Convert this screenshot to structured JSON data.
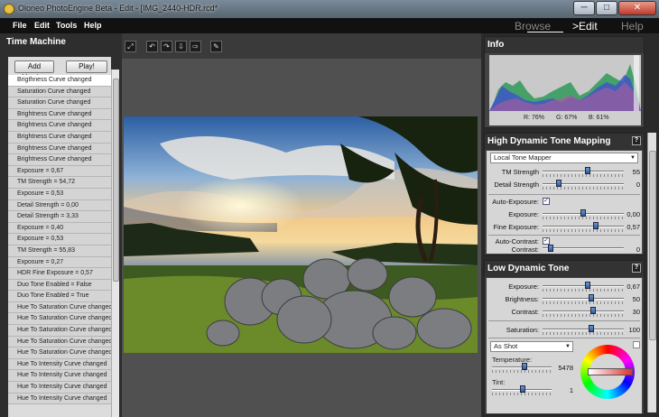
{
  "window": {
    "title": "Oloneo PhotoEngine Beta - Edit - [IMG_2440-HDR.rcd*",
    "minimize": "─",
    "maximize": "□",
    "close": "✕"
  },
  "menu": {
    "file": "File",
    "edit": "Edit",
    "tools": "Tools",
    "help": "Help"
  },
  "modes": {
    "browse": "Browse",
    "edit": ">Edit",
    "help": "Help"
  },
  "time_machine": {
    "title": "Time Machine",
    "add_version": "Add Version",
    "play": "Play!",
    "items": [
      "Brigthness Curve changed",
      "Saturation Curve changed",
      "Saturation Curve changed",
      "Brightness Curve changed",
      "Brightness Curve changed",
      "Brightness Curve changed",
      "Brightness Curve changed",
      "Brightness Curve changed",
      "Exposure = 0,67",
      "TM Strength = 54,72",
      "Exposure = 0,53",
      "Detail Strength = 0,00",
      "Detail Strength = 3,33",
      "Exposure = 0,40",
      "Exposure = 0,53",
      "TM Strength = 55,83",
      "Exposure = 0,27",
      "HDR Fine Exposure = 0,57",
      "Duo Tone Enabled = False",
      "Duo Tone Enabled = True",
      "Hue To Saturation Curve changed",
      "Hue To Saturation Curve changed",
      "Hue To Saturation Curve changed",
      "Hue To Saturation Curve changed",
      "Hue To Saturation Curve changed",
      "Hue To Intensity Curve changed",
      "Hue To Intensity Curve changed",
      "Hue To Intensity Curve changed",
      "Hue To Intensity Curve changed"
    ]
  },
  "toolbar_icons": [
    "fit-icon",
    "rotate-left-icon",
    "rotate-right-icon",
    "flip-vertical-icon",
    "flip-horizontal-icon",
    "crop-icon"
  ],
  "info": {
    "title": "Info",
    "r": "R: 76%",
    "g": "G: 67%",
    "b": "B: 61%"
  },
  "hdr": {
    "title": "High Dynamic Tone Mapping",
    "help": "?",
    "mapper": "Local Tone Mapper",
    "tm_strength": {
      "label": "TM Strength",
      "value": "55",
      "level": 0.55
    },
    "detail_strength": {
      "label": "Detail Strength",
      "value": "0",
      "level": 0.2
    },
    "auto_exposure": {
      "label": "Auto-Exposure:",
      "checked": "✓"
    },
    "exposure": {
      "label": "Exposure:",
      "value": "0,00",
      "level": 0.5
    },
    "fine_exposure": {
      "label": "Fine Exposure:",
      "value": "0,57",
      "level": 0.65
    },
    "auto_contrast": {
      "label": "Auto-Contrast:",
      "checked": "✓"
    },
    "contrast": {
      "label": "Contrast:",
      "value": "0",
      "level": 0.1
    }
  },
  "ldr": {
    "title": "Low Dynamic Tone",
    "help": "?",
    "exposure": {
      "label": "Exposure:",
      "value": "0,67",
      "level": 0.55
    },
    "brightness": {
      "label": "Brightness:",
      "value": "50",
      "level": 0.6
    },
    "contrast": {
      "label": "Contrast:",
      "value": "30",
      "level": 0.62
    },
    "saturation": {
      "label": "Saturation:",
      "value": "100",
      "level": 0.6
    },
    "white_balance": "As Shot",
    "temperature": {
      "label": "Temperature:",
      "value": "5478",
      "level": 0.55
    },
    "tint": {
      "label": "Tint:",
      "value": "1",
      "level": 0.52
    }
  }
}
